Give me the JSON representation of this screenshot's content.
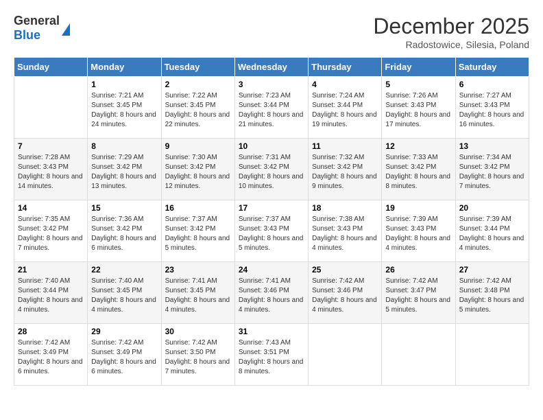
{
  "logo": {
    "general": "General",
    "blue": "Blue"
  },
  "header": {
    "month": "December 2025",
    "location": "Radostowice, Silesia, Poland"
  },
  "weekdays": [
    "Sunday",
    "Monday",
    "Tuesday",
    "Wednesday",
    "Thursday",
    "Friday",
    "Saturday"
  ],
  "weeks": [
    [
      {
        "day": "",
        "info": ""
      },
      {
        "day": "1",
        "info": "Sunrise: 7:21 AM\nSunset: 3:45 PM\nDaylight: 8 hours and 24 minutes."
      },
      {
        "day": "2",
        "info": "Sunrise: 7:22 AM\nSunset: 3:45 PM\nDaylight: 8 hours and 22 minutes."
      },
      {
        "day": "3",
        "info": "Sunrise: 7:23 AM\nSunset: 3:44 PM\nDaylight: 8 hours and 21 minutes."
      },
      {
        "day": "4",
        "info": "Sunrise: 7:24 AM\nSunset: 3:44 PM\nDaylight: 8 hours and 19 minutes."
      },
      {
        "day": "5",
        "info": "Sunrise: 7:26 AM\nSunset: 3:43 PM\nDaylight: 8 hours and 17 minutes."
      },
      {
        "day": "6",
        "info": "Sunrise: 7:27 AM\nSunset: 3:43 PM\nDaylight: 8 hours and 16 minutes."
      }
    ],
    [
      {
        "day": "7",
        "info": "Sunrise: 7:28 AM\nSunset: 3:43 PM\nDaylight: 8 hours and 14 minutes."
      },
      {
        "day": "8",
        "info": "Sunrise: 7:29 AM\nSunset: 3:42 PM\nDaylight: 8 hours and 13 minutes."
      },
      {
        "day": "9",
        "info": "Sunrise: 7:30 AM\nSunset: 3:42 PM\nDaylight: 8 hours and 12 minutes."
      },
      {
        "day": "10",
        "info": "Sunrise: 7:31 AM\nSunset: 3:42 PM\nDaylight: 8 hours and 10 minutes."
      },
      {
        "day": "11",
        "info": "Sunrise: 7:32 AM\nSunset: 3:42 PM\nDaylight: 8 hours and 9 minutes."
      },
      {
        "day": "12",
        "info": "Sunrise: 7:33 AM\nSunset: 3:42 PM\nDaylight: 8 hours and 8 minutes."
      },
      {
        "day": "13",
        "info": "Sunrise: 7:34 AM\nSunset: 3:42 PM\nDaylight: 8 hours and 7 minutes."
      }
    ],
    [
      {
        "day": "14",
        "info": "Sunrise: 7:35 AM\nSunset: 3:42 PM\nDaylight: 8 hours and 7 minutes."
      },
      {
        "day": "15",
        "info": "Sunrise: 7:36 AM\nSunset: 3:42 PM\nDaylight: 8 hours and 6 minutes."
      },
      {
        "day": "16",
        "info": "Sunrise: 7:37 AM\nSunset: 3:42 PM\nDaylight: 8 hours and 5 minutes."
      },
      {
        "day": "17",
        "info": "Sunrise: 7:37 AM\nSunset: 3:43 PM\nDaylight: 8 hours and 5 minutes."
      },
      {
        "day": "18",
        "info": "Sunrise: 7:38 AM\nSunset: 3:43 PM\nDaylight: 8 hours and 4 minutes."
      },
      {
        "day": "19",
        "info": "Sunrise: 7:39 AM\nSunset: 3:43 PM\nDaylight: 8 hours and 4 minutes."
      },
      {
        "day": "20",
        "info": "Sunrise: 7:39 AM\nSunset: 3:44 PM\nDaylight: 8 hours and 4 minutes."
      }
    ],
    [
      {
        "day": "21",
        "info": "Sunrise: 7:40 AM\nSunset: 3:44 PM\nDaylight: 8 hours and 4 minutes."
      },
      {
        "day": "22",
        "info": "Sunrise: 7:40 AM\nSunset: 3:45 PM\nDaylight: 8 hours and 4 minutes."
      },
      {
        "day": "23",
        "info": "Sunrise: 7:41 AM\nSunset: 3:45 PM\nDaylight: 8 hours and 4 minutes."
      },
      {
        "day": "24",
        "info": "Sunrise: 7:41 AM\nSunset: 3:46 PM\nDaylight: 8 hours and 4 minutes."
      },
      {
        "day": "25",
        "info": "Sunrise: 7:42 AM\nSunset: 3:46 PM\nDaylight: 8 hours and 4 minutes."
      },
      {
        "day": "26",
        "info": "Sunrise: 7:42 AM\nSunset: 3:47 PM\nDaylight: 8 hours and 5 minutes."
      },
      {
        "day": "27",
        "info": "Sunrise: 7:42 AM\nSunset: 3:48 PM\nDaylight: 8 hours and 5 minutes."
      }
    ],
    [
      {
        "day": "28",
        "info": "Sunrise: 7:42 AM\nSunset: 3:49 PM\nDaylight: 8 hours and 6 minutes."
      },
      {
        "day": "29",
        "info": "Sunrise: 7:42 AM\nSunset: 3:49 PM\nDaylight: 8 hours and 6 minutes."
      },
      {
        "day": "30",
        "info": "Sunrise: 7:42 AM\nSunset: 3:50 PM\nDaylight: 8 hours and 7 minutes."
      },
      {
        "day": "31",
        "info": "Sunrise: 7:43 AM\nSunset: 3:51 PM\nDaylight: 8 hours and 8 minutes."
      },
      {
        "day": "",
        "info": ""
      },
      {
        "day": "",
        "info": ""
      },
      {
        "day": "",
        "info": ""
      }
    ]
  ]
}
